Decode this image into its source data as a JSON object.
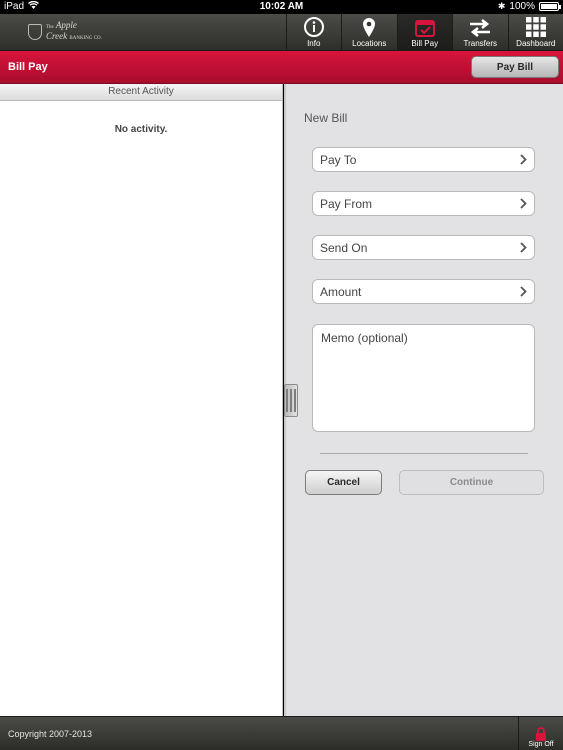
{
  "status_bar": {
    "device": "iPad",
    "time": "10:02 AM",
    "battery": "100%",
    "battery_level": 1.0
  },
  "brand": {
    "line1": "The",
    "line2": "Apple",
    "line3": "Creek",
    "line4": "BANKING CO."
  },
  "nav": {
    "tabs": [
      {
        "label": "Info",
        "icon": "info-icon"
      },
      {
        "label": "Locations",
        "icon": "location-pin-icon"
      },
      {
        "label": "Bill Pay",
        "icon": "calendar-check-icon"
      },
      {
        "label": "Transfers",
        "icon": "transfer-arrows-icon"
      },
      {
        "label": "Dashboard",
        "icon": "grid-icon"
      }
    ],
    "active": "Bill Pay"
  },
  "titlebar": {
    "title": "Bill Pay",
    "action_label": "Pay Bill"
  },
  "recent_activity": {
    "header": "Recent Activity",
    "empty_text": "No activity."
  },
  "new_bill": {
    "heading": "New Bill",
    "fields": [
      {
        "label": "Pay To"
      },
      {
        "label": "Pay From"
      },
      {
        "label": "Send On"
      },
      {
        "label": "Amount"
      }
    ],
    "memo_placeholder": "Memo (optional)",
    "cancel_label": "Cancel",
    "continue_label": "Continue"
  },
  "footer": {
    "copyright": "Copyright 2007-2013",
    "signoff_label": "Sign Off"
  },
  "colors": {
    "brand_red": "#c4102f",
    "nav_dark": "#3a3a37",
    "pane_gray": "#e2e2e4"
  }
}
